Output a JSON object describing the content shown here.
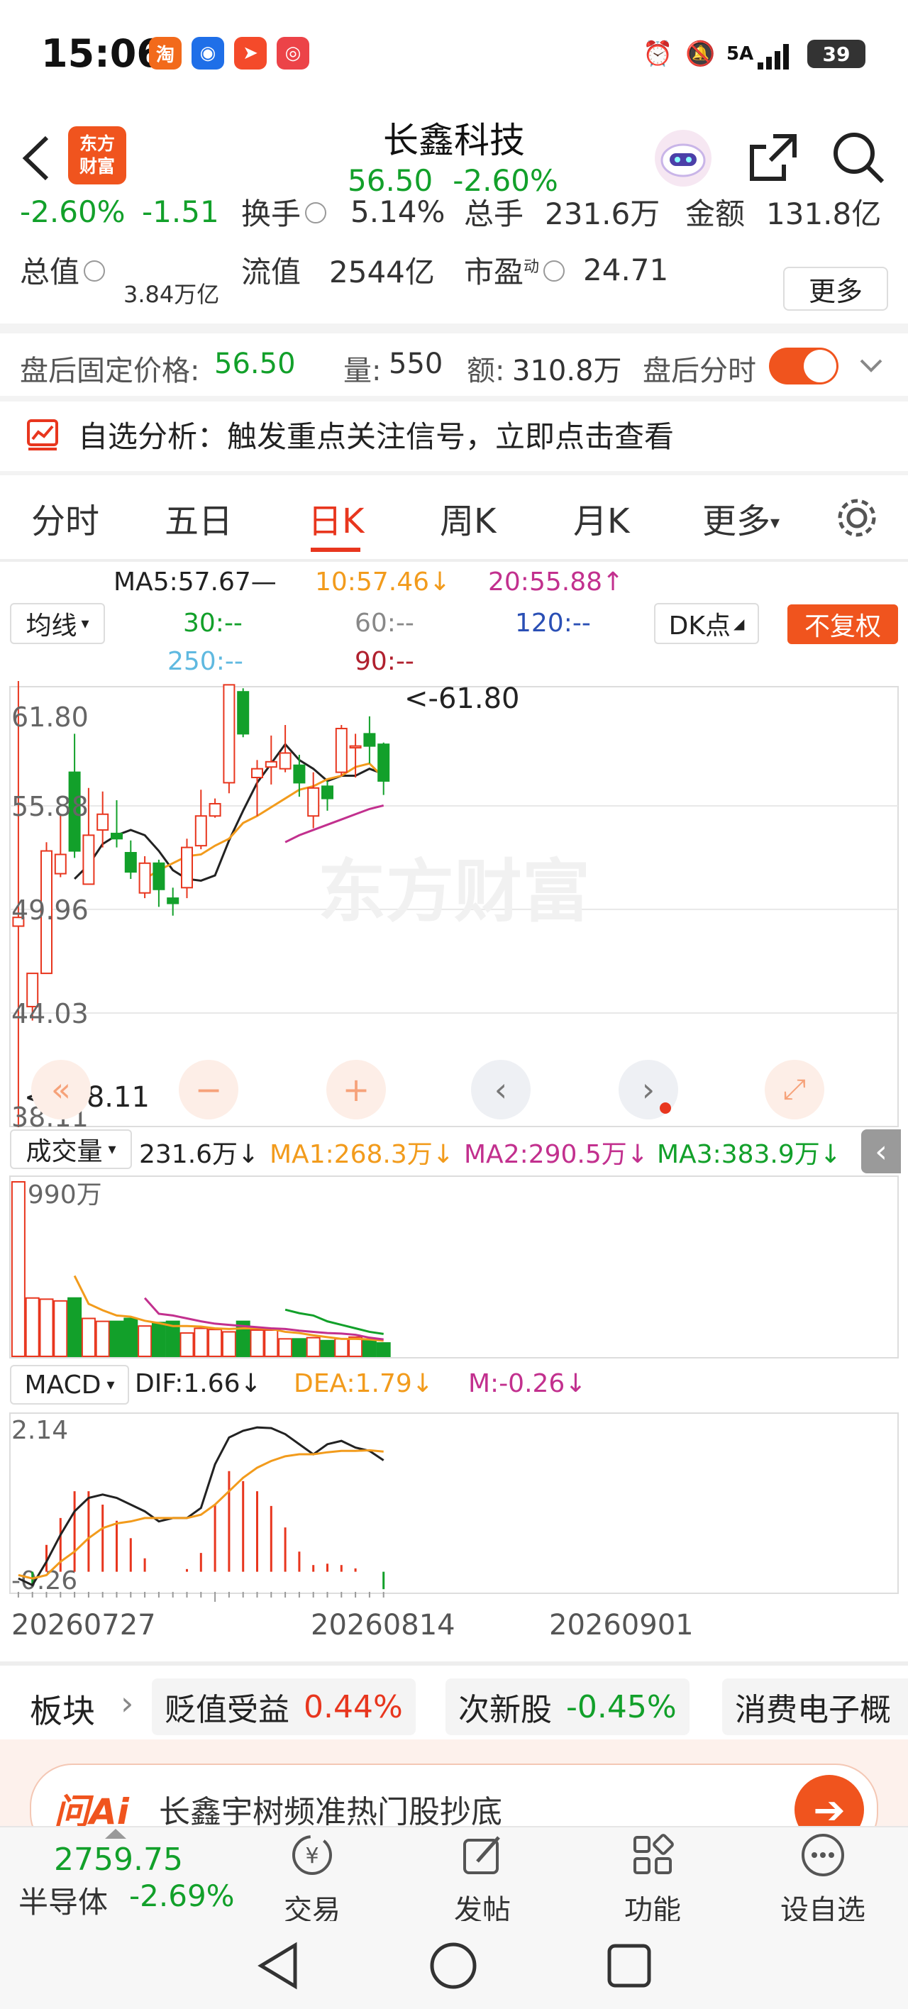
{
  "status_bar": {
    "time": "15:06",
    "battery": "39",
    "network": "5A"
  },
  "header": {
    "name": "长鑫科技",
    "price": "56.50",
    "change_pct": "-2.60%",
    "logo_line1": "东方",
    "logo_line2": "财富"
  },
  "quote": {
    "change_pct": "-2.60%",
    "change_amt": "-1.51",
    "turnover_label": "换手",
    "turnover": "5.14%",
    "volume_label": "总手",
    "volume": "231.6万",
    "amount_label": "金额",
    "amount": "131.8亿",
    "mktcap_label": "总值",
    "mktcap": "3.84万亿",
    "float_label": "流值",
    "float": "2544亿",
    "pe_label": "市盈",
    "pe_sup": "动",
    "pe": "24.71",
    "more": "更多"
  },
  "after_hours": {
    "label": "盘后固定价格:",
    "price": "56.50",
    "vol_label": "量:",
    "vol": "550",
    "amt_label": "额:",
    "amt": "310.8万",
    "chart_label": "盘后分时"
  },
  "notice": {
    "label": "自选分析：",
    "text": "触发重点关注信号，立即点击查看"
  },
  "tabs": [
    "分时",
    "五日",
    "日K",
    "周K",
    "月K",
    "更多"
  ],
  "active_tab": "日K",
  "ma": {
    "selector": "均线",
    "ma5": "MA5:57.67—",
    "ma10": "10:57.46↓",
    "ma20": "20:55.88↑",
    "ma30": "30:--",
    "ma60": "60:--",
    "ma120": "120:--",
    "ma250": "250:--",
    "ma90": "90:--",
    "dk": "DK点",
    "fq": "不复权"
  },
  "price_axis": [
    "61.80",
    "55.88",
    "49.96",
    "44.03",
    "38.11"
  ],
  "annotations": {
    "high": "61.80",
    "low": "38.11"
  },
  "watermark": "东方财富",
  "volume_bar": {
    "selector": "成交量",
    "vol": "231.6万↓",
    "ma1": "MA1:268.3万↓",
    "ma2": "MA2:290.5万↓",
    "ma3": "MA3:383.9万↓",
    "axis_top": "2990万"
  },
  "macd_bar": {
    "selector": "MACD",
    "dif": "DIF:1.66↓",
    "dea": "DEA:1.79↓",
    "m": "M:-0.26↓",
    "axis_top": "2.14",
    "axis_bottom": "-0.26"
  },
  "dates": [
    "20260727",
    "20260814",
    "20260901"
  ],
  "sectors": {
    "label": "板块",
    "items": [
      {
        "name": "贬值受益",
        "pct": "0.44%"
      },
      {
        "name": "次新股",
        "pct": "-0.45%"
      },
      {
        "name": "消费电子概",
        "pct": ""
      }
    ]
  },
  "ai_banner": {
    "logo": "问Ai",
    "text": "长鑫宇树频准热门股抄底"
  },
  "bottom_index": {
    "value": "2759.75",
    "name": "半导体",
    "pct": "-2.69%"
  },
  "nav": [
    "交易",
    "发帖",
    "功能",
    "设自选"
  ],
  "colors": {
    "up": "#e8361e",
    "down": "#12a02a",
    "accent": "#f0541e"
  },
  "chart_data": {
    "type": "candlestick",
    "candles": [
      {
        "o": 49.0,
        "c": 49.5,
        "h": 65.0,
        "l": 37.5
      },
      {
        "o": 44.4,
        "c": 46.3,
        "h": 46.3,
        "l": 43.6
      },
      {
        "o": 46.3,
        "c": 53.3,
        "h": 53.8,
        "l": 46.3
      },
      {
        "o": 52.0,
        "c": 53.1,
        "h": 55.4,
        "l": 51.8
      },
      {
        "o": 57.8,
        "c": 53.3,
        "h": 60.0,
        "l": 52.9
      },
      {
        "o": 51.4,
        "c": 54.2,
        "h": 56.9,
        "l": 51.4
      },
      {
        "o": 54.5,
        "c": 55.4,
        "h": 56.7,
        "l": 53.5
      },
      {
        "o": 54.3,
        "c": 54.0,
        "h": 56.2,
        "l": 53.5
      },
      {
        "o": 53.2,
        "c": 52.1,
        "h": 53.9,
        "l": 51.7
      },
      {
        "o": 50.9,
        "c": 52.6,
        "h": 53.0,
        "l": 50.6
      },
      {
        "o": 52.6,
        "c": 51.1,
        "h": 52.8,
        "l": 50.1
      },
      {
        "o": 50.6,
        "c": 50.3,
        "h": 51.2,
        "l": 49.6
      },
      {
        "o": 51.2,
        "c": 53.5,
        "h": 54.0,
        "l": 50.6
      },
      {
        "o": 53.6,
        "c": 55.3,
        "h": 56.8,
        "l": 53.4
      },
      {
        "o": 55.3,
        "c": 56.0,
        "h": 56.3,
        "l": 55.2
      },
      {
        "o": 57.2,
        "c": 62.8,
        "h": 62.8,
        "l": 56.6
      },
      {
        "o": 62.4,
        "c": 60.0,
        "h": 62.6,
        "l": 59.8
      },
      {
        "o": 57.5,
        "c": 58.0,
        "h": 58.5,
        "l": 55.3
      },
      {
        "o": 58.1,
        "c": 58.4,
        "h": 59.9,
        "l": 57.1
      },
      {
        "o": 58.0,
        "c": 58.9,
        "h": 60.5,
        "l": 57.8
      },
      {
        "o": 58.2,
        "c": 57.2,
        "h": 58.8,
        "l": 56.4
      },
      {
        "o": 55.3,
        "c": 56.9,
        "h": 57.8,
        "l": 54.6
      },
      {
        "o": 57.0,
        "c": 56.3,
        "h": 57.3,
        "l": 55.6
      },
      {
        "o": 57.8,
        "c": 60.3,
        "h": 60.5,
        "l": 57.6
      },
      {
        "o": 59.2,
        "c": 59.3,
        "h": 60.0,
        "l": 57.5
      },
      {
        "o": 60.0,
        "c": 59.3,
        "h": 61.0,
        "l": 58.3
      },
      {
        "o": 59.4,
        "c": 57.3,
        "h": 59.5,
        "l": 56.5
      }
    ],
    "ma5": [
      null,
      null,
      null,
      null,
      51.7,
      52.5,
      53.7,
      54.2,
      54.5,
      54.2,
      53.3,
      52.2,
      51.7,
      51.6,
      51.9,
      53.9,
      55.6,
      57.2,
      58.3,
      59.4,
      58.5,
      58.0,
      57.3,
      57.6,
      57.6,
      58.0,
      57.7
    ],
    "ma10": [
      null,
      null,
      null,
      null,
      null,
      null,
      null,
      null,
      null,
      51.7,
      52.2,
      52.6,
      53.0,
      53.1,
      53.6,
      54.0,
      54.9,
      55.3,
      55.8,
      56.3,
      56.8,
      57.0,
      57.4,
      57.6,
      58.1,
      58.3,
      57.5
    ],
    "ma20": [
      null,
      null,
      null,
      null,
      null,
      null,
      null,
      null,
      null,
      null,
      null,
      null,
      null,
      null,
      null,
      null,
      null,
      null,
      null,
      53.8,
      54.2,
      54.5,
      54.8,
      55.1,
      55.4,
      55.7,
      55.9
    ],
    "volume": [
      2990,
      1000,
      980,
      950,
      1000,
      650,
      600,
      600,
      650,
      520,
      580,
      600,
      400,
      480,
      460,
      420,
      600,
      450,
      450,
      300,
      300,
      320,
      270,
      300,
      330,
      280,
      230
    ],
    "vol_ma1": [
      null,
      null,
      null,
      null,
      1380,
      900,
      790,
      700,
      680,
      610,
      570,
      520,
      520,
      510,
      480,
      470,
      480,
      480,
      470,
      420,
      400,
      360,
      330,
      300,
      300,
      290,
      268
    ],
    "vol_ma2": [
      null,
      null,
      null,
      null,
      null,
      null,
      null,
      null,
      null,
      1000,
      730,
      700,
      650,
      600,
      560,
      540,
      520,
      500,
      480,
      470,
      440,
      420,
      400,
      390,
      370,
      320,
      290
    ],
    "vol_ma3": [
      null,
      null,
      null,
      null,
      null,
      null,
      null,
      null,
      null,
      null,
      null,
      null,
      null,
      null,
      null,
      null,
      null,
      null,
      null,
      800,
      740,
      700,
      600,
      540,
      480,
      420,
      384
    ],
    "dif": [
      -0.1,
      -0.2,
      0.15,
      0.55,
      0.9,
      1.1,
      1.15,
      1.1,
      1.0,
      0.9,
      0.75,
      0.8,
      0.8,
      0.95,
      1.6,
      2.0,
      2.1,
      2.15,
      2.14,
      2.05,
      1.9,
      1.75,
      1.9,
      1.95,
      1.85,
      1.8,
      1.66
    ],
    "dea": [
      -0.05,
      -0.1,
      -0.05,
      0.15,
      0.3,
      0.5,
      0.65,
      0.72,
      0.75,
      0.8,
      0.8,
      0.8,
      0.8,
      0.85,
      1.0,
      1.2,
      1.4,
      1.55,
      1.65,
      1.72,
      1.75,
      1.75,
      1.78,
      1.8,
      1.8,
      1.81,
      1.79
    ],
    "m": [
      0.0,
      -0.2,
      0.4,
      0.8,
      1.2,
      1.2,
      1.0,
      0.76,
      0.5,
      0.2,
      0.0,
      0.0,
      0.04,
      0.28,
      1.0,
      1.5,
      1.35,
      1.2,
      0.98,
      0.66,
      0.3,
      0.1,
      0.12,
      0.1,
      0.05,
      0.0,
      -0.26
    ],
    "dates": [
      "20260727",
      "20260814",
      "20260901"
    ],
    "ylim": [
      38.11,
      61.8
    ]
  }
}
